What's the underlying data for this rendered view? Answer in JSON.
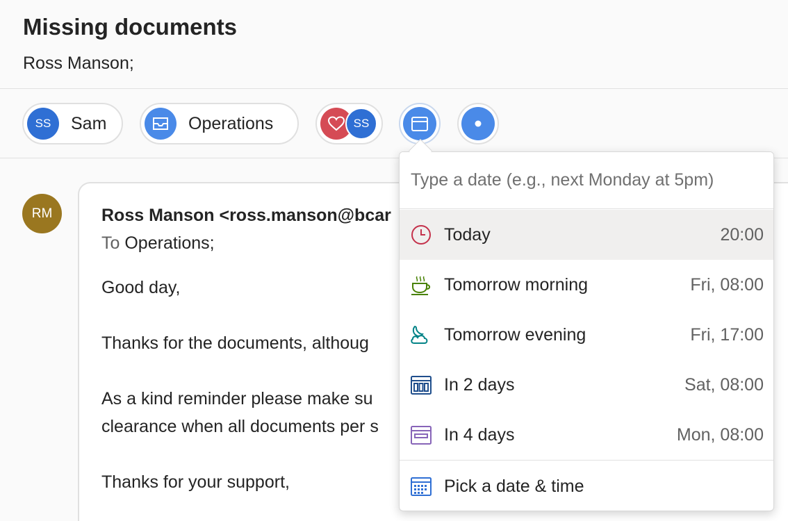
{
  "header": {
    "subject": "Missing documents",
    "recipients": "Ross Manson;"
  },
  "chips": {
    "sam": {
      "initials": "SS",
      "label": "Sam"
    },
    "operations": {
      "label": "Operations"
    },
    "group": {
      "initials": "SS"
    }
  },
  "message": {
    "avatar_initials": "RM",
    "from": "Ross Manson <ross.manson@bcar",
    "to_label": "To",
    "to_value": "Operations;",
    "lines": [
      "Good day,",
      "Thanks for the documents, althoug",
      "As a kind reminder please make su",
      "clearance when all documents per s",
      "Thanks for your support,"
    ]
  },
  "snooze": {
    "placeholder": "Type a date (e.g., next Monday at 5pm)",
    "options": [
      {
        "label": "Today",
        "time": "20:00"
      },
      {
        "label": "Tomorrow morning",
        "time": "Fri, 08:00"
      },
      {
        "label": "Tomorrow evening",
        "time": "Fri, 17:00"
      },
      {
        "label": "In 2 days",
        "time": "Sat, 08:00"
      },
      {
        "label": "In 4 days",
        "time": "Mon, 08:00"
      }
    ],
    "pick": "Pick a date & time"
  },
  "colors": {
    "accent": "#4a8ae8",
    "today_icon": "#c4314b",
    "morning_icon": "#498205",
    "evening_icon": "#038387",
    "two_days_icon": "#1f4e8c",
    "four_days_icon": "#8764b8",
    "pick_icon": "#2f6fd4"
  },
  "icons": {
    "chip_inbox": "inbox-icon",
    "group_heart": "heart-icon",
    "calendar_button": "calendar-icon",
    "dot_button": "dot-icon",
    "today": "clock-icon",
    "tomorrow_morning": "coffee-cup-icon",
    "tomorrow_evening": "cloud-moon-icon",
    "in_2_days": "calendar-week-icon",
    "in_4_days": "calendar-icon",
    "pick": "calendar-grid-icon"
  }
}
